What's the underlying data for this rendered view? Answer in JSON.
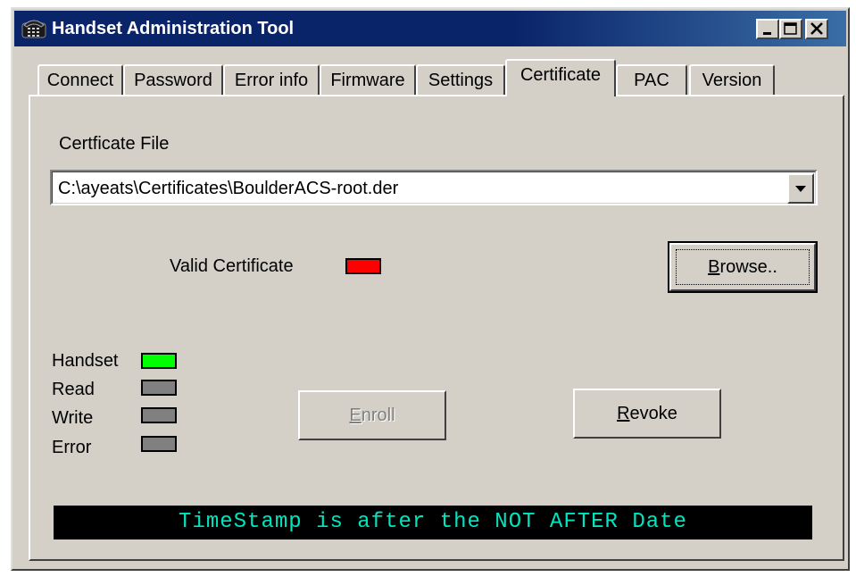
{
  "window": {
    "title": "Handset Administration Tool",
    "app_icon": "telephone-icon",
    "controls": {
      "minimize": "minimize-icon",
      "maximize": "maximize-icon",
      "close": "close-icon"
    }
  },
  "tabs": [
    {
      "label": "Connect"
    },
    {
      "label": "Password"
    },
    {
      "label": "Error info"
    },
    {
      "label": "Firmware"
    },
    {
      "label": "Settings"
    },
    {
      "label": "Certificate",
      "active": true
    },
    {
      "label": "PAC"
    },
    {
      "label": "Version"
    }
  ],
  "certificate": {
    "file_label": "Certficate File",
    "file_value": "C:\\ayeats\\Certificates\\BoulderACS-root.der",
    "valid_label": "Valid Certificate",
    "valid_color": "#ff0000",
    "browse_button": "Browse..",
    "browse_mnemonic": "B",
    "enroll_button": "Enroll",
    "enroll_mnemonic": "E",
    "revoke_button": "Revoke",
    "revoke_mnemonic": "R"
  },
  "indicators": [
    {
      "label": "Handset",
      "color": "#00ff00"
    },
    {
      "label": "Read",
      "color": "#808080"
    },
    {
      "label": "Write",
      "color": "#808080"
    },
    {
      "label": "Error",
      "color": "#808080"
    }
  ],
  "status_message": "TimeStamp is after the NOT AFTER Date",
  "colors": {
    "title_bar": "#0a246a",
    "status_bg": "#000000",
    "status_text": "#00e5c0"
  }
}
